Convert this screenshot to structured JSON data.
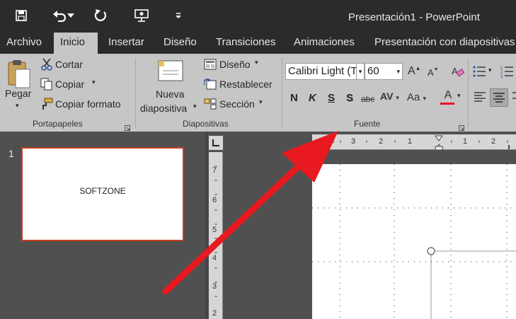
{
  "window": {
    "title": "Presentación1 - PowerPoint"
  },
  "quick_access": {
    "icons": [
      "save-icon",
      "undo-icon",
      "undo-dropdown-icon",
      "redo-icon",
      "present-icon",
      "customize-icon"
    ]
  },
  "tabs": [
    {
      "label": "Archivo"
    },
    {
      "label": "Inicio"
    },
    {
      "label": "Insertar"
    },
    {
      "label": "Diseño"
    },
    {
      "label": "Transiciones"
    },
    {
      "label": "Animaciones"
    },
    {
      "label": "Presentación con diapositivas"
    }
  ],
  "ribbon": {
    "clipboard": {
      "paste": "Pegar",
      "cut": "Cortar",
      "copy": "Copiar",
      "format_painter": "Copiar formato",
      "group_label": "Portapapeles"
    },
    "slides": {
      "new_slide_line1": "Nueva",
      "new_slide_line2": "diapositiva",
      "layout": "Diseño",
      "reset": "Restablecer",
      "section": "Sección",
      "group_label": "Diapositivas"
    },
    "font": {
      "font_name": "Calibri Light (T",
      "font_size": "60",
      "bold": "N",
      "italic": "K",
      "underline": "S",
      "shadow": "S",
      "strike": "abc",
      "spacing": "AV",
      "case": "Aa",
      "color": "A",
      "grow": "A",
      "shrink": "A",
      "group_label": "Fuente"
    }
  },
  "slides_panel": {
    "slide_number": "1",
    "slide_text": "SOFTZONE"
  },
  "rulers": {
    "horizontal": [
      "3",
      "2",
      "1",
      "1",
      "2"
    ],
    "vertical": [
      "7",
      "6",
      "5",
      "4",
      "3",
      "2"
    ]
  },
  "colors": {
    "accent": "#c43e1c",
    "arrow": "#e8191f",
    "font_color_bar": "#e81123"
  }
}
